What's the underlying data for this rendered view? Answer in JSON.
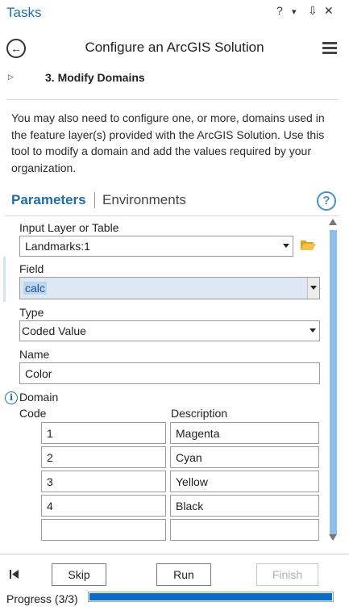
{
  "window": {
    "title": "Tasks",
    "controls": [
      "?",
      "▾",
      "⇩",
      "✕"
    ]
  },
  "header": {
    "title": "Configure an ArcGIS Solution"
  },
  "step": {
    "label": "3.  Modify Domains"
  },
  "description": "You may also need to configure one, or more, domains used in the feature layer(s) provided with the ArcGIS Solution. Use this tool to modify a domain and add the values required by your organization.",
  "tabs": {
    "parameters": "Parameters",
    "environments": "Environments"
  },
  "params": {
    "input_layer": {
      "label": "Input Layer or Table",
      "value": "Landmarks:1"
    },
    "field": {
      "label": "Field",
      "value": "calc"
    },
    "type": {
      "label": "Type",
      "value": "Coded Value"
    },
    "name": {
      "label": "Name",
      "value": "Color"
    },
    "domain": {
      "label": "Domain",
      "code_header": "Code",
      "description_header": "Description",
      "rows": [
        {
          "code": "1",
          "description": "Magenta"
        },
        {
          "code": "2",
          "description": "Cyan"
        },
        {
          "code": "3",
          "description": "Yellow"
        },
        {
          "code": "4",
          "description": "Black"
        },
        {
          "code": "",
          "description": ""
        }
      ]
    }
  },
  "footer": {
    "skip_label": "Skip",
    "run_label": "Run",
    "finish_label": "Finish",
    "progress_label": "Progress (3/3)",
    "progress_fraction": 1.0
  },
  "colors": {
    "accent": "#1e6ea8",
    "progress": "#0a6cc4",
    "scrollbar": "#8ebfe8"
  }
}
